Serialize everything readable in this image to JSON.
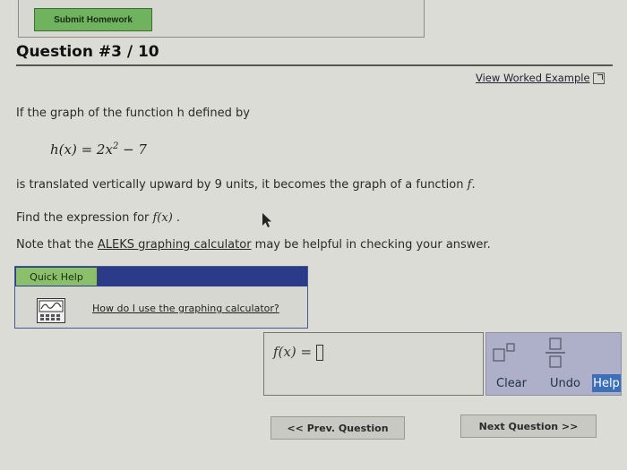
{
  "header": {
    "submit_label": "Submit Homework"
  },
  "question": {
    "title": "Question #3 / 10",
    "worked_example_label": "View Worked Example",
    "line1": "If the graph of the function h defined by",
    "equation": {
      "lhs": "h(x) = 2x",
      "exp": "2",
      "rhs": " − 7"
    },
    "line2_pre": "is translated vertically upward by 9 units, it becomes the graph of a function ",
    "line2_f": "f",
    "line2_post": ".",
    "line3_pre": "Find the expression for ",
    "line3_fx": "f(x)",
    "line3_post": " .",
    "note_pre": "Note that the ",
    "note_link": "ALEKS graphing calculator",
    "note_post": " may be helpful in checking your answer."
  },
  "quick_help": {
    "tab_label": "Quick Help",
    "link_label": "How do I use the graphing calculator?",
    "icon": "graph-calculator-icon"
  },
  "answer": {
    "label": "f(x) =",
    "value": ""
  },
  "tools": {
    "clear_label": "Clear",
    "undo_label": "Undo",
    "help_label": "Help"
  },
  "nav": {
    "prev_label": "<< Prev. Question",
    "next_label": "Next Question >>"
  },
  "colors": {
    "submit_green": "#6fb35f",
    "quick_help_blue": "#2b3b8a",
    "tool_panel": "#aeb0c9",
    "help_button": "#3d6fb8"
  }
}
